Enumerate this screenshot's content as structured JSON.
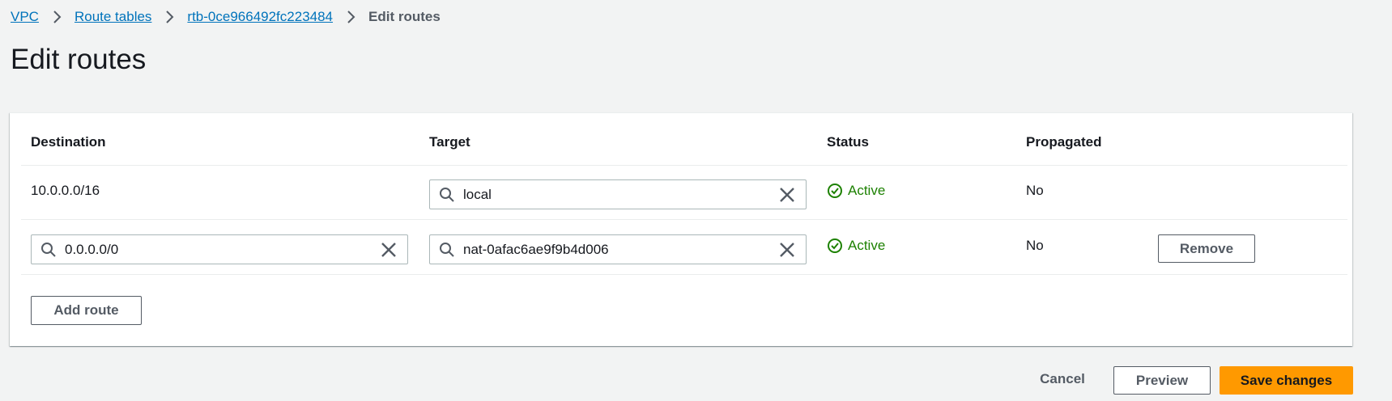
{
  "breadcrumb": {
    "items": [
      "VPC",
      "Route tables",
      "rtb-0ce966492fc223484"
    ],
    "current": "Edit routes"
  },
  "page_title": "Edit routes",
  "table": {
    "columns": [
      "Destination",
      "Target",
      "Status",
      "Propagated"
    ],
    "rows": [
      {
        "destination": "10.0.0.0/16",
        "target": "local",
        "status": "Active",
        "propagated": "No"
      },
      {
        "destination": "0.0.0.0/0",
        "target": "nat-0afac6ae9f9b4d006",
        "status": "Active",
        "propagated": "No",
        "remove_label": "Remove"
      }
    ],
    "add_route_label": "Add route"
  },
  "footer": {
    "cancel_label": "Cancel",
    "preview_label": "Preview",
    "save_label": "Save changes"
  },
  "colors": {
    "link": "#0073bb",
    "status_active": "#1d8102",
    "primary": "#ff9900"
  },
  "icons": [
    "chevron-right-icon",
    "search-icon",
    "clear-icon",
    "status-positive-icon"
  ]
}
